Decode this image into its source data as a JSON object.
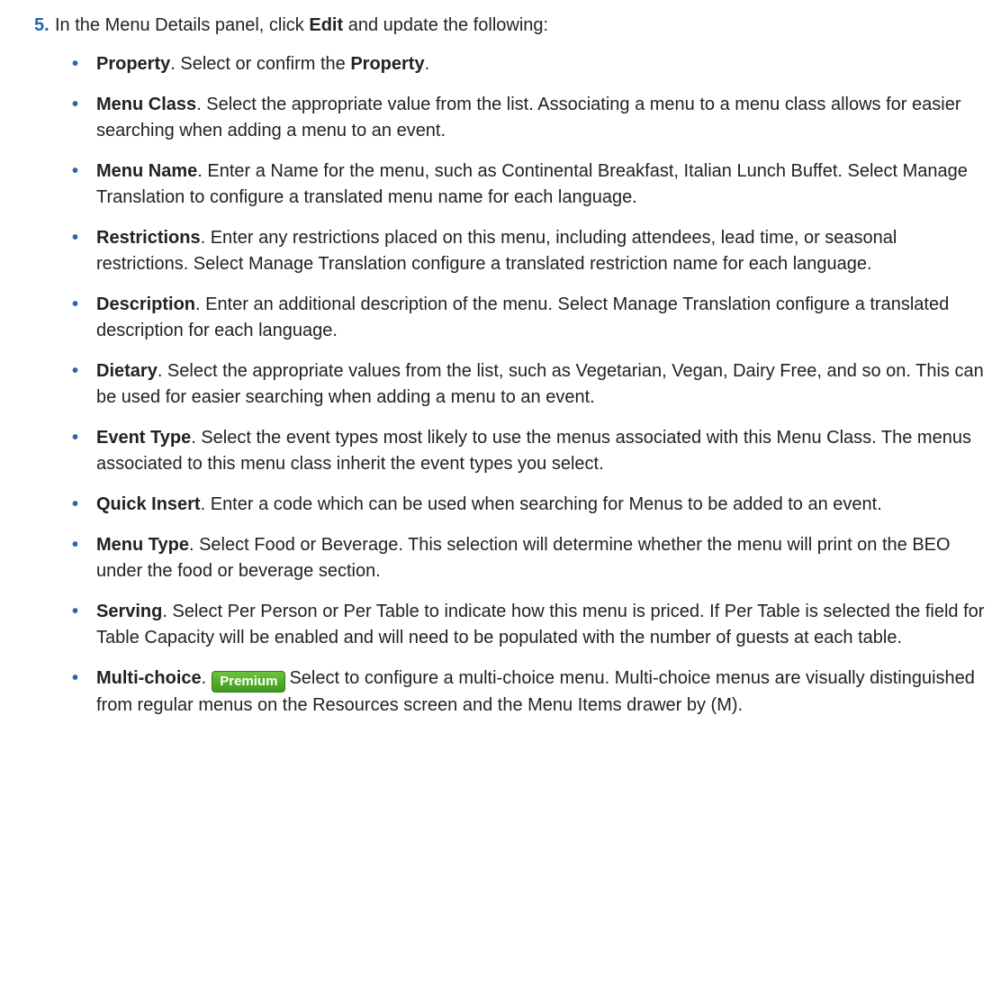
{
  "step": {
    "number": "5.",
    "pre": "In the Menu Details panel, click ",
    "bold": "Edit",
    "post": " and update the following:"
  },
  "items": [
    {
      "term": "Property",
      "text": ". Select or confirm the ",
      "bold2": "Property",
      "text2": "."
    },
    {
      "term": "Menu Class",
      "text": ". Select the appropriate value from the list. Associating a menu to a menu class allows for easier searching when adding a menu to an event."
    },
    {
      "term": "Menu Name",
      "text": ". Enter a Name for the menu, such as Continental Breakfast, Italian Lunch Buffet. Select Manage Translation to configure a translated menu name for each language."
    },
    {
      "term": "Restrictions",
      "text": ". Enter any restrictions placed on this menu, including attendees, lead time, or seasonal restrictions. Select Manage Translation configure a translated restriction name for each language."
    },
    {
      "term": "Description",
      "text": ". Enter an additional description of the menu. Select Manage Translation configure a translated description for each language."
    },
    {
      "term": "Dietary",
      "text": ". Select the appropriate values from the list, such as Vegetarian, Vegan, Dairy Free, and so on. This can be used for easier searching when adding a menu to an event."
    },
    {
      "term": "Event Type",
      "text": ". Select the event types most likely to use the menus associated with this Menu Class. The menus associated to this menu class inherit the event types you select."
    },
    {
      "term": "Quick Insert",
      "text": ". Enter a code which can be used when searching for Menus to be added to an event."
    },
    {
      "term": "Menu Type",
      "text": ". Select Food or Beverage. This selection will determine whether the menu will print on the BEO under the food or beverage section."
    },
    {
      "term": "Serving",
      "text": ". Select Per Person or Per Table to indicate how this menu is priced. If Per Table is selected the field for Table Capacity will be enabled and will need to be populated with the number of guests at each table."
    },
    {
      "term": "Multi-choice",
      "text": ".",
      "badge": "Premium",
      "text2": "Select to configure a multi-choice menu. Multi-choice menus are visually distinguished from regular menus on the Resources screen and the Menu Items drawer by (M)."
    }
  ],
  "bullet_symbol": "•",
  "colors": {
    "accent": "#2a66b0",
    "badge": "#4aa826"
  }
}
